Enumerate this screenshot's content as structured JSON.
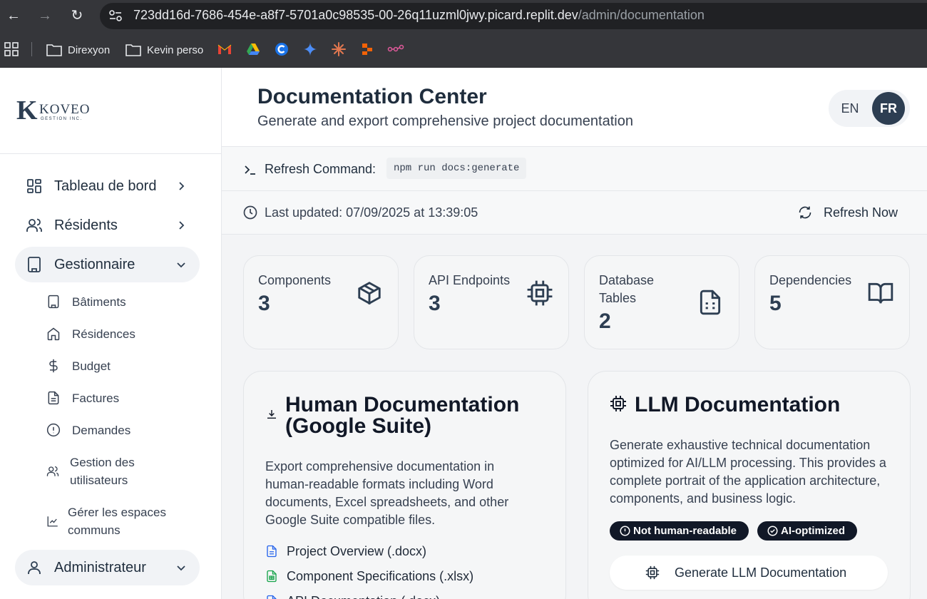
{
  "browser": {
    "url_host": "723dd16d-7686-454e-a8f7-5701a0c98535-00-26q11uzml0jwy.picard.replit.dev",
    "url_path": "/admin/documentation",
    "bookmarks": [
      {
        "label": "Direxyon",
        "icon": "folder-icon"
      },
      {
        "label": "Kevin perso",
        "icon": "folder-icon"
      }
    ],
    "bookmark_icons": [
      "gmail-icon",
      "drive-icon",
      "c-app-icon",
      "gemini-icon",
      "claude-icon",
      "app-icon",
      "link-icon"
    ]
  },
  "sidebar": {
    "logo": {
      "name": "KOVEO",
      "sub": "GESTION INC."
    },
    "items": [
      {
        "label": "Tableau de bord",
        "icon": "dashboard-icon",
        "state": "collapsed"
      },
      {
        "label": "Résidents",
        "icon": "users-icon",
        "state": "collapsed"
      },
      {
        "label": "Gestionnaire",
        "icon": "building-icon",
        "state": "expanded"
      },
      {
        "label": "Administrateur",
        "icon": "user-icon",
        "state": "expanded"
      }
    ],
    "gestionnaire_sub": [
      {
        "label": "Bâtiments",
        "icon": "building-icon"
      },
      {
        "label": "Résidences",
        "icon": "home-icon"
      },
      {
        "label": "Budget",
        "icon": "dollar-icon"
      },
      {
        "label": "Factures",
        "icon": "file-text-icon"
      },
      {
        "label": "Demandes",
        "icon": "alert-circle-icon"
      },
      {
        "label": "Gestion des utilisateurs",
        "icon": "users-icon"
      },
      {
        "label": "Gérer les espaces communs",
        "icon": "chart-icon"
      }
    ]
  },
  "header": {
    "title": "Documentation Center",
    "subtitle": "Generate and export comprehensive project documentation",
    "lang": {
      "en": "EN",
      "fr": "FR",
      "active": "FR"
    }
  },
  "command": {
    "label": "Refresh Command:",
    "code": "npm run docs:generate"
  },
  "updated": {
    "text": "Last updated: 07/09/2025 at 13:39:05",
    "refresh_label": "Refresh Now"
  },
  "stats": [
    {
      "label": "Components",
      "value": "3",
      "icon": "box-icon"
    },
    {
      "label": "API Endpoints",
      "value": "3",
      "icon": "cpu-icon"
    },
    {
      "label": "Database Tables",
      "value": "2",
      "icon": "file-text-icon"
    },
    {
      "label": "Dependencies",
      "value": "5",
      "icon": "book-open-icon"
    }
  ],
  "human_doc": {
    "title": "Human Documentation (Google Suite)",
    "description": "Export comprehensive documentation in human-readable formats including Word documents, Excel spreadsheets, and other Google Suite compatible files.",
    "files": [
      {
        "label": "Project Overview (.docx)",
        "color": "#2563eb"
      },
      {
        "label": "Component Specifications (.xlsx)",
        "color": "#16a34a"
      },
      {
        "label": "API Documentation (.docx)",
        "color": "#2563eb"
      }
    ]
  },
  "llm_doc": {
    "title": "LLM Documentation",
    "description": "Generate exhaustive technical documentation optimized for AI/LLM processing. This provides a complete portrait of the application architecture, components, and business logic.",
    "badges": [
      "Not human-readable",
      "AI-optimized"
    ],
    "button_label": "Generate LLM Documentation"
  },
  "colors": {
    "brand": "#2d3e52",
    "sidebar_active": "#f1f3f6",
    "badge": "#111827"
  }
}
